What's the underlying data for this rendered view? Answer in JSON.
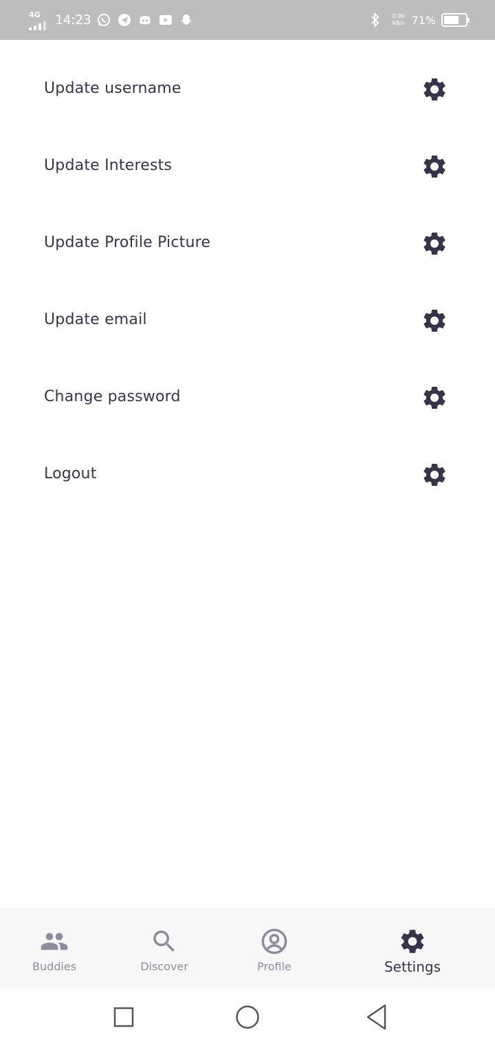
{
  "status_bar": {
    "network": "4G",
    "time": "14:23",
    "speed_value": "0.00",
    "speed_unit": "KB/s",
    "battery_percent": "71%",
    "battery_level": 0.71,
    "notification_icons": [
      "whatsapp-icon",
      "telegram-icon",
      "discord-icon",
      "youtube-icon",
      "snapchat-icon"
    ],
    "right_icons": [
      "bluetooth-icon"
    ]
  },
  "settings": {
    "items": [
      {
        "label": "Update username",
        "icon": "gear-icon"
      },
      {
        "label": "Update Interests",
        "icon": "gear-icon"
      },
      {
        "label": "Update Profile Picture",
        "icon": "gear-icon"
      },
      {
        "label": "Update email",
        "icon": "gear-icon"
      },
      {
        "label": "Change password",
        "icon": "gear-icon"
      },
      {
        "label": "Logout",
        "icon": "gear-icon"
      }
    ]
  },
  "bottom_nav": {
    "items": [
      {
        "label": "Buddies",
        "icon": "people-icon",
        "active": false
      },
      {
        "label": "Discover",
        "icon": "search-icon",
        "active": false
      },
      {
        "label": "Profile",
        "icon": "account-circle-icon",
        "active": false
      },
      {
        "label": "Settings",
        "icon": "gear-icon",
        "active": true
      }
    ]
  },
  "system_nav": {
    "buttons": [
      "recents-square-icon",
      "home-circle-icon",
      "back-triangle-icon"
    ]
  },
  "colors": {
    "status_bar_bg": "#bdbdbd",
    "text_primary": "#37344a",
    "icon_dark": "#37344a",
    "nav_inactive": "#8e8b9c",
    "nav_bg": "#f7f7f7"
  }
}
